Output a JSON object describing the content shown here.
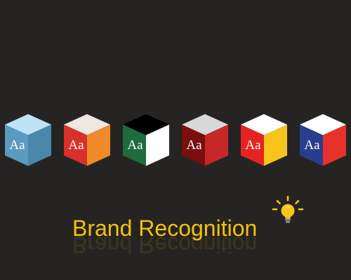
{
  "title": "Brand Recognition",
  "cube_letters": "Aa",
  "cubes": [
    {
      "name": "cube-light-blue",
      "top": "#bfe3f5",
      "left": "#5b9ac1",
      "right": "#4a87ab",
      "letters": "#ffffff"
    },
    {
      "name": "cube-orange",
      "top": "#ece7df",
      "left": "#d9302b",
      "right": "#f08a2b",
      "letters": "#ffffff"
    },
    {
      "name": "cube-green-black",
      "top": "#000000",
      "left": "#1e6b3d",
      "right": "#ffffff",
      "letters": "#ffffff"
    },
    {
      "name": "cube-maroon",
      "top": "#d8d8d8",
      "left": "#7a0f0f",
      "right": "#c62828",
      "letters": "#ffffff"
    },
    {
      "name": "cube-red-yellow",
      "top": "#ffffff",
      "left": "#e62222",
      "right": "#f7c41c",
      "letters": "#ffffff"
    },
    {
      "name": "cube-blue-red",
      "top": "#ffffff",
      "left": "#273e8f",
      "right": "#e8312a",
      "letters": "#ffffff"
    }
  ],
  "colors": {
    "background": "#262422",
    "title": "#f4c20d",
    "bulb": "#f7c41c",
    "bulb_base": "#8e8e8e"
  },
  "icons": [
    "lightbulb-icon"
  ]
}
